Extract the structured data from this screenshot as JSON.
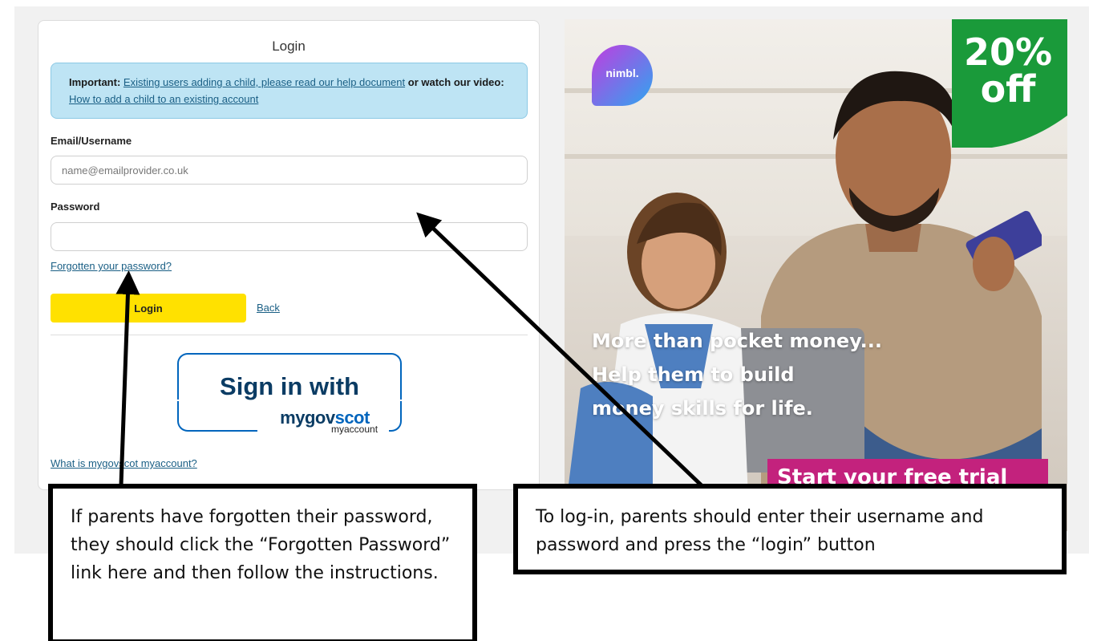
{
  "login": {
    "title": "Login",
    "notice": {
      "important_label": "Important:",
      "help_link": "Existing users adding a child, please read our help document",
      "or_watch": "or watch our",
      "video_label": "video:",
      "video_link": "How to add a child to an existing account"
    },
    "email_label": "Email/Username",
    "email_placeholder": "name@emailprovider.co.uk",
    "email_value": "",
    "password_label": "Password",
    "password_value": "",
    "forgot_link": "Forgotten your password?",
    "login_button": "Login",
    "back_link": "Back",
    "mygovscot": {
      "sign_in": "Sign in with",
      "brand_my": "mygov",
      "brand_scot": "scot",
      "sub": "myaccount"
    },
    "what_is_link": "What is mygovscot myaccount?"
  },
  "ad": {
    "logo_text": "nimbl.",
    "discount_line1": "20%",
    "discount_line2": "off",
    "headline_line1": "More than pocket money...",
    "headline_line2": "Help them to build",
    "headline_line3": "money skills for life.",
    "cta": "Start your free trial",
    "colors": {
      "cta": "#c3227d",
      "badge": "#1a9a3a"
    }
  },
  "callouts": {
    "forgot": "If parents have forgotten their password, they should click the “Forgotten Password” link here and then follow the instructions.",
    "login": "To log-in, parents should enter their username and password and press the “login” button"
  },
  "colors": {
    "login_button": "#ffe100",
    "notice_bg": "#bee4f4",
    "link": "#1a5f85",
    "gov_blue": "#0065bd"
  }
}
